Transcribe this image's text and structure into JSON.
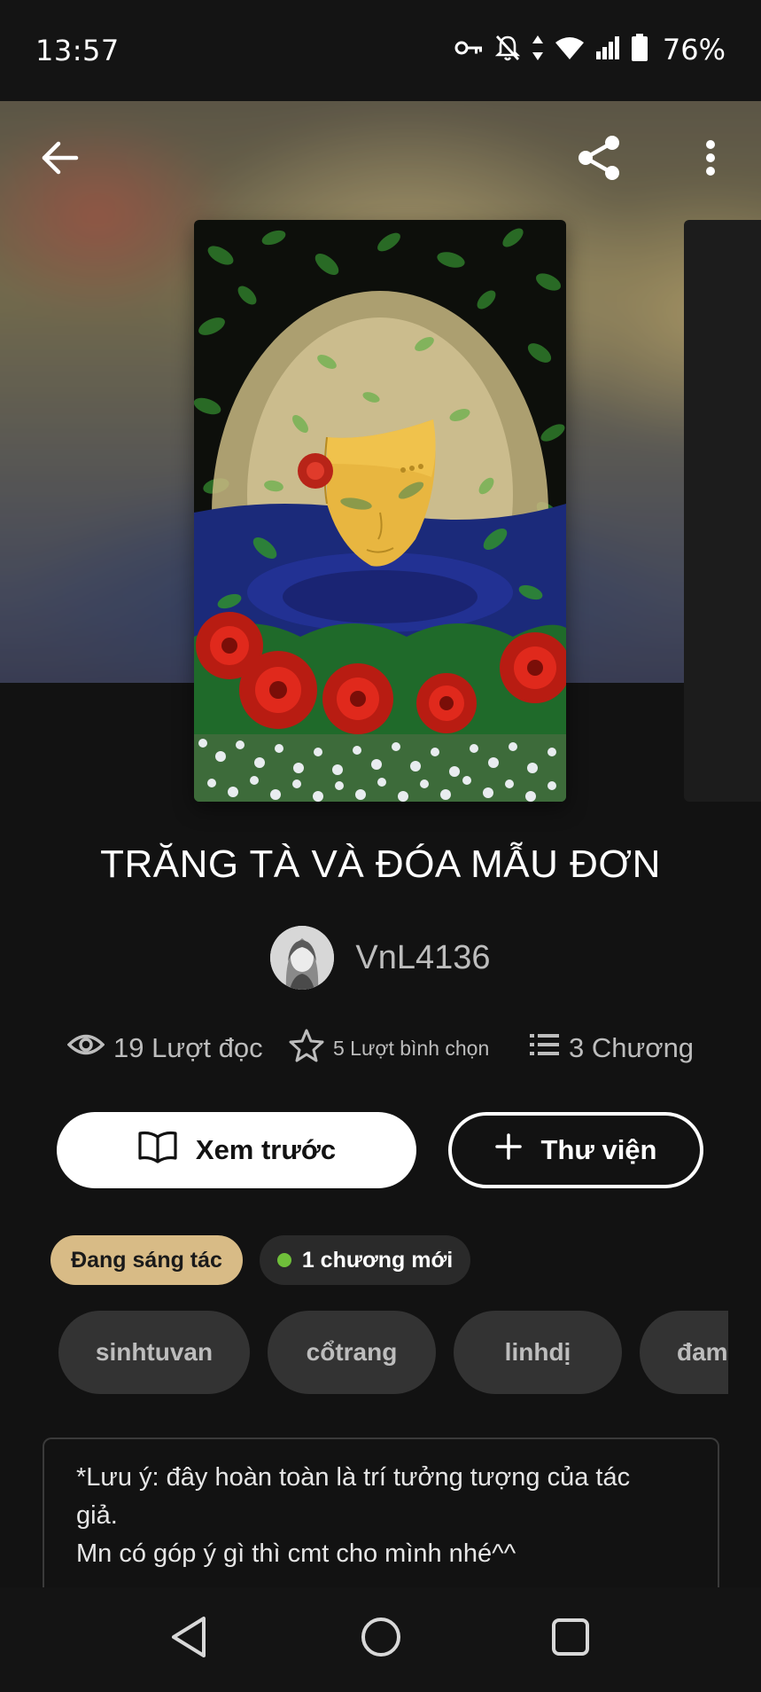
{
  "status_bar": {
    "time": "13:57",
    "icons": [
      "vpn-key-icon",
      "bell-off-icon",
      "data-arrows-icon",
      "wifi-icon",
      "signal-icon",
      "battery-icon"
    ],
    "battery_percent": "76%"
  },
  "header": {
    "back_icon": "arrow-left-icon",
    "share_icon": "share-icon",
    "more_icon": "more-vert-icon"
  },
  "story": {
    "title": "TRĂNG TÀ VÀ ĐÓA MẪU ĐƠN",
    "author": "VnL4136",
    "stats": {
      "reads": "19 Lượt đọc",
      "votes": "5 Lượt bình chọn",
      "chapters": "3 Chương"
    }
  },
  "actions": {
    "read_label": "Xem trước",
    "library_label": "Thư viện"
  },
  "status_chips": {
    "ongoing": "Đang sáng tác",
    "new_chapters": "1 chương mới"
  },
  "tags": [
    "sinhtuvan",
    "cổtrang",
    "linhdị",
    "đam"
  ],
  "description": {
    "line1": "*Lưu ý: đây hoàn toàn là trí tưởng tượng của tác",
    "line2": "giả.",
    "line3": "Mn có góp ý gì thì cmt cho mình nhé^^"
  },
  "colors": {
    "background": "#121212",
    "chip_ongoing": "#d8bb86",
    "chip_dot": "#6fbf3a",
    "tag_bg": "#333333"
  },
  "nav": {
    "back_icon": "triangle-back-icon",
    "home_icon": "circle-home-icon",
    "recents_icon": "square-recents-icon"
  }
}
